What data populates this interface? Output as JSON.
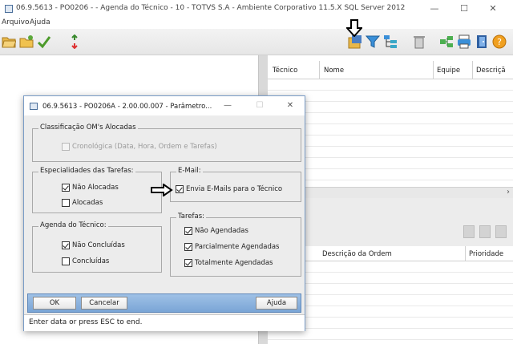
{
  "window": {
    "title": "06.9.5613 - PO0206 -  - Agenda do Técnico - 10 - TOTVS S.A - Ambiente Corporativo 11.5.X SQL Server 2012",
    "minimize": "—",
    "maximize": "☐",
    "close": "✕"
  },
  "menu": {
    "arquivo": "Arquivo",
    "ajuda": "Ajuda"
  },
  "toolbar_icons": [
    "folder-open-icon",
    "new-folder-icon",
    "checkmark-icon",
    "refresh-arrows-icon",
    "export-icon",
    "filter-icon",
    "tree-icon",
    "trash-icon",
    "link-icon",
    "printer-icon",
    "exit-door-icon",
    "help-icon"
  ],
  "grid_top": {
    "headers": [
      "Técnico",
      "Nome",
      "Equipe",
      "Descriçã"
    ]
  },
  "grid_bottom": {
    "headers": [
      "Descrição da Ordem",
      "Prioridade"
    ]
  },
  "dialog": {
    "title": "06.9.5613 - PO0206A - 2.00.00.007 - Parâmetro...",
    "minimize": "—",
    "maximize": "☐",
    "close": "✕",
    "group_classificacao": {
      "legend": "Classificação OM's Alocadas",
      "cronologica": {
        "label": "Cronológica (Data, Hora, Ordem e Tarefas)",
        "checked": false,
        "disabled": true
      }
    },
    "group_especialidades": {
      "legend": "Especialidades das Tarefas:",
      "nao_alocadas": {
        "label": "Não Alocadas",
        "checked": true
      },
      "alocadas": {
        "label": "Alocadas",
        "checked": false
      }
    },
    "group_email": {
      "legend": "E-Mail:",
      "envia": {
        "label": "Envia E-Mails para o Técnico",
        "checked": true
      }
    },
    "group_agenda": {
      "legend": "Agenda do Técnico:",
      "nao_concluidas": {
        "label": "Não Concluídas",
        "checked": true
      },
      "concluidas": {
        "label": "Concluídas",
        "checked": false
      }
    },
    "group_tarefas": {
      "legend": "Tarefas:",
      "nao_agendadas": {
        "label": "Não Agendadas",
        "checked": true
      },
      "parcialmente": {
        "label": "Parcialmente Agendadas",
        "checked": true
      },
      "totalmente": {
        "label": "Totalmente Agendadas",
        "checked": true
      }
    },
    "buttons": {
      "ok": "OK",
      "cancelar": "Cancelar",
      "ajuda": "Ajuda"
    },
    "status": "Enter data or press ESC to end."
  },
  "colors": {
    "accent": "#7aa5d6",
    "dialog_border": "#7a9cc6"
  }
}
